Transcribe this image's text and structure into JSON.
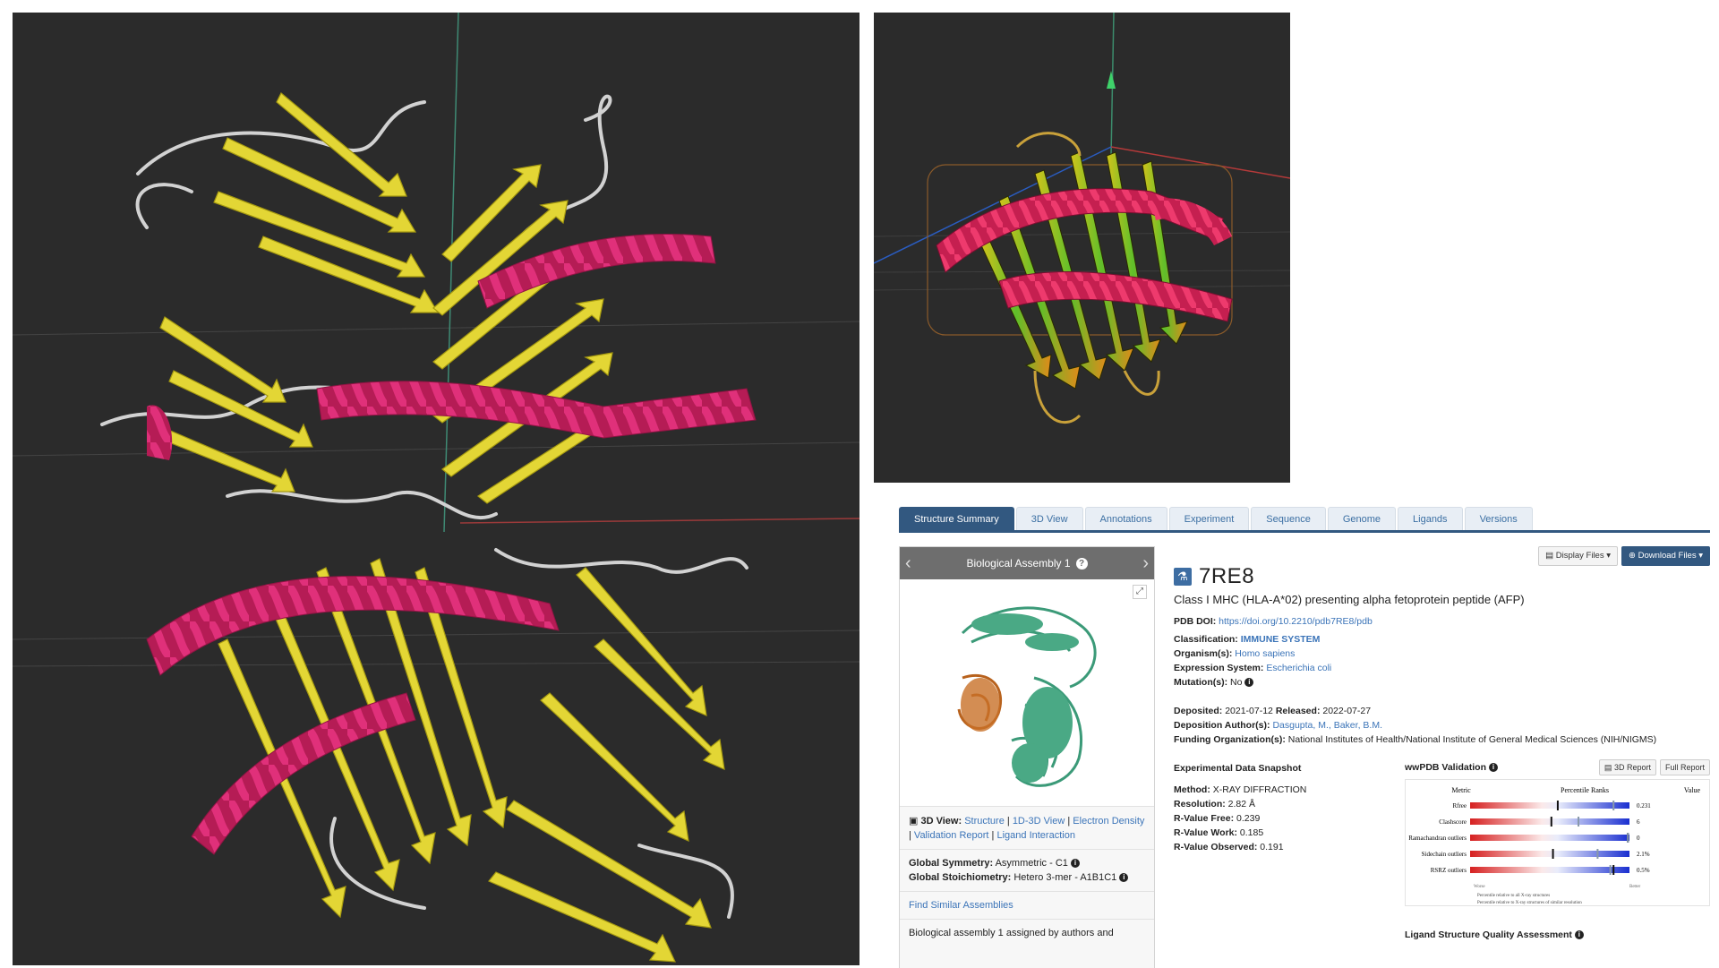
{
  "tabs": [
    "Structure Summary",
    "3D View",
    "Annotations",
    "Experiment",
    "Sequence",
    "Genome",
    "Ligands",
    "Versions"
  ],
  "assembly": {
    "title": "Biological Assembly 1",
    "view_label": "3D View:",
    "links": [
      "Structure",
      "1D-3D View",
      "Electron Density",
      "Validation Report",
      "Ligand Interaction"
    ],
    "symmetry_label": "Global Symmetry:",
    "symmetry_value": "Asymmetric - C1",
    "stoich_label": "Global Stoichiometry:",
    "stoich_value": "Hetero 3-mer - A1B1C1",
    "find_similar": "Find Similar Assemblies",
    "note": "Biological assembly 1 assigned by authors and"
  },
  "entry": {
    "display_files": "Display Files",
    "download_files": "Download Files",
    "id": "7RE8",
    "title": "Class I MHC (HLA-A*02) presenting alpha fetoprotein peptide (AFP)",
    "doi_label": "PDB DOI:",
    "doi": "https://doi.org/10.2210/pdb7RE8/pdb",
    "classification_label": "Classification:",
    "classification": "IMMUNE SYSTEM",
    "organism_label": "Organism(s):",
    "organism": "Homo sapiens",
    "expression_label": "Expression System:",
    "expression": "Escherichia coli",
    "mutation_label": "Mutation(s):",
    "mutation": "No",
    "deposited_label": "Deposited:",
    "deposited": "2021-07-12",
    "released_label": "Released:",
    "released": "2022-07-27",
    "authors_label": "Deposition Author(s):",
    "authors": "Dasgupta, M., Baker, B.M.",
    "funding_label": "Funding Organization(s):",
    "funding": "National Institutes of Health/National Institute of General Medical Sciences (NIH/NIGMS)"
  },
  "snapshot": {
    "heading": "Experimental Data Snapshot",
    "rows": [
      {
        "label": "Method:",
        "value": "X-RAY DIFFRACTION"
      },
      {
        "label": "Resolution:",
        "value": "2.82 Å"
      },
      {
        "label": "R-Value Free:",
        "value": "0.239"
      },
      {
        "label": "R-Value Work:",
        "value": "0.185"
      },
      {
        "label": "R-Value Observed:",
        "value": "0.191"
      }
    ]
  },
  "validation": {
    "heading": "wwPDB Validation",
    "report_3d": "3D Report",
    "full_report": "Full Report",
    "col_metric": "Metric",
    "col_ranks": "Percentile Ranks",
    "col_value": "Value",
    "metrics": [
      {
        "name": "Rfree",
        "value": "0.231",
        "pct_all": 0.55,
        "pct_res": 0.9
      },
      {
        "name": "Clashscore",
        "value": "6",
        "pct_all": 0.51,
        "pct_res": 0.68
      },
      {
        "name": "Ramachandran outliers",
        "value": "0",
        "pct_all": 0.99,
        "pct_res": 0.99
      },
      {
        "name": "Sidechain outliers",
        "value": "2.1%",
        "pct_all": 0.52,
        "pct_res": 0.8
      },
      {
        "name": "RSRZ outliers",
        "value": "0.5%",
        "pct_all": 0.9,
        "pct_res": 0.88
      }
    ],
    "worse": "Worse",
    "better": "Better",
    "legend1": "Percentile relative to all X-ray structures",
    "legend2": "Percentile relative to X-ray structures of similar resolution"
  },
  "ligand_heading": "Ligand Structure Quality Assessment",
  "colors": {
    "helix": "#c8215f",
    "sheet": "#e6dc3a",
    "coil": "#cfcfcf",
    "bg": "#2b2b2b",
    "accent": "#325880"
  }
}
